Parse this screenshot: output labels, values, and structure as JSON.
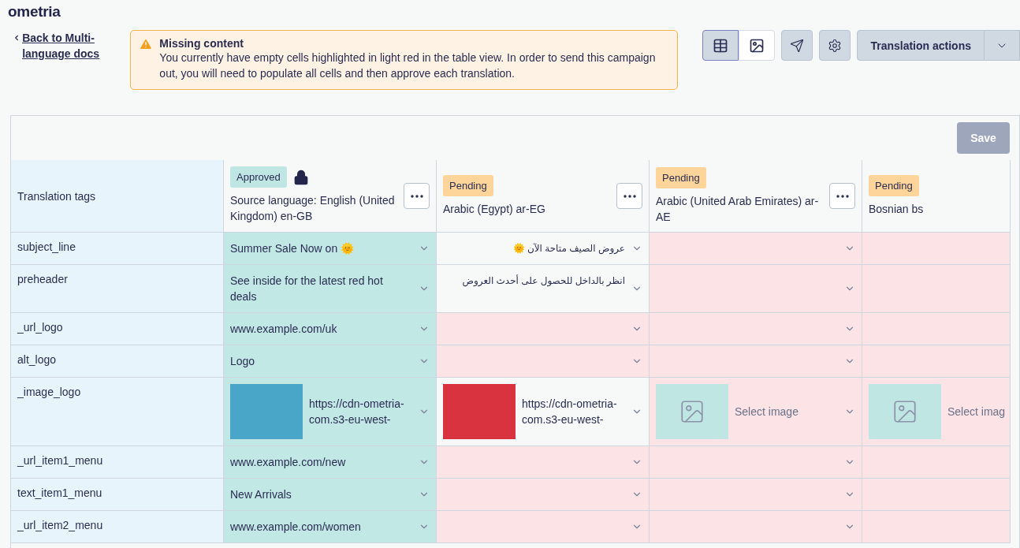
{
  "logo": "ometria",
  "back_link": "Back to Multi-language docs",
  "alert": {
    "title": "Missing content",
    "message": "You currently have empty cells highlighted in light red in the table view. In order to send this campaign out, you will need to populate all cells and then approve each translation."
  },
  "view_toggle": [
    {
      "kind": "table",
      "selected": true
    },
    {
      "kind": "image",
      "selected": false
    }
  ],
  "actions_button": "Translation actions",
  "save_button": {
    "label": "Save",
    "disabled": true
  },
  "tags_header": "Translation tags",
  "columns": [
    {
      "badge": "Approved",
      "approved": true,
      "locked": true,
      "title": "Source language: English (United Kingdom) en-GB",
      "controls": true
    },
    {
      "badge": "Pending",
      "approved": false,
      "locked": false,
      "title": "Arabic (Egypt) ar-EG",
      "controls": true
    },
    {
      "badge": "Pending",
      "approved": false,
      "locked": false,
      "title": "Arabic (United Arab Emirates) ar-AE",
      "controls": true
    },
    {
      "badge": "Pending",
      "approved": false,
      "locked": false,
      "title": "Bosnian bs",
      "controls": false
    }
  ],
  "rows": [
    {
      "tag": "subject_line",
      "cells": [
        {
          "kind": "text",
          "missing": false,
          "text": "Summer Sale Now on 🌞"
        },
        {
          "kind": "text",
          "missing": false,
          "text": "عروض الصيف متاحة الآن 🌞",
          "rtl": true
        },
        {
          "kind": "empty",
          "missing": true
        },
        {
          "kind": "empty",
          "missing": true
        }
      ]
    },
    {
      "tag": "preheader",
      "cells": [
        {
          "kind": "text",
          "missing": false,
          "text": "See inside for the latest red hot deals"
        },
        {
          "kind": "text",
          "missing": false,
          "text": "انظر بالداخل للحصول على أحدث العروض",
          "rtl": true
        },
        {
          "kind": "empty",
          "missing": true
        },
        {
          "kind": "empty",
          "missing": true
        }
      ]
    },
    {
      "tag": "_url_logo",
      "cells": [
        {
          "kind": "text",
          "missing": false,
          "text": "www.example.com/uk"
        },
        {
          "kind": "empty",
          "missing": true
        },
        {
          "kind": "empty",
          "missing": true
        },
        {
          "kind": "empty",
          "missing": true
        }
      ]
    },
    {
      "tag": "alt_logo",
      "cells": [
        {
          "kind": "text",
          "missing": false,
          "text": "Logo"
        },
        {
          "kind": "empty",
          "missing": true
        },
        {
          "kind": "empty",
          "missing": true
        },
        {
          "kind": "empty",
          "missing": true
        }
      ]
    },
    {
      "tag": "_image_logo",
      "cells": [
        {
          "kind": "image",
          "missing": false,
          "text": "https://cdn-ometria-com.s3-eu-west-",
          "color": "#4aa6c9"
        },
        {
          "kind": "image",
          "missing": false,
          "text": "https://cdn-ometria-com.s3-eu-west-",
          "color": "#d8333f"
        },
        {
          "kind": "image_select",
          "missing": true,
          "text": "Select image"
        },
        {
          "kind": "image_select",
          "missing": true,
          "text": "Select imag"
        }
      ]
    },
    {
      "tag": "_url_item1_menu",
      "cells": [
        {
          "kind": "text",
          "missing": false,
          "text": "www.example.com/new"
        },
        {
          "kind": "empty",
          "missing": true
        },
        {
          "kind": "empty",
          "missing": true
        },
        {
          "kind": "empty",
          "missing": true
        }
      ]
    },
    {
      "tag": "text_item1_menu",
      "cells": [
        {
          "kind": "text",
          "missing": false,
          "text": "New Arrivals"
        },
        {
          "kind": "empty",
          "missing": true
        },
        {
          "kind": "empty",
          "missing": true
        },
        {
          "kind": "empty",
          "missing": true
        }
      ]
    },
    {
      "tag": "_url_item2_menu",
      "cells": [
        {
          "kind": "text",
          "missing": false,
          "text": "www.example.com/women"
        },
        {
          "kind": "empty",
          "missing": true
        },
        {
          "kind": "empty",
          "missing": true
        },
        {
          "kind": "empty",
          "missing": true
        }
      ]
    }
  ]
}
